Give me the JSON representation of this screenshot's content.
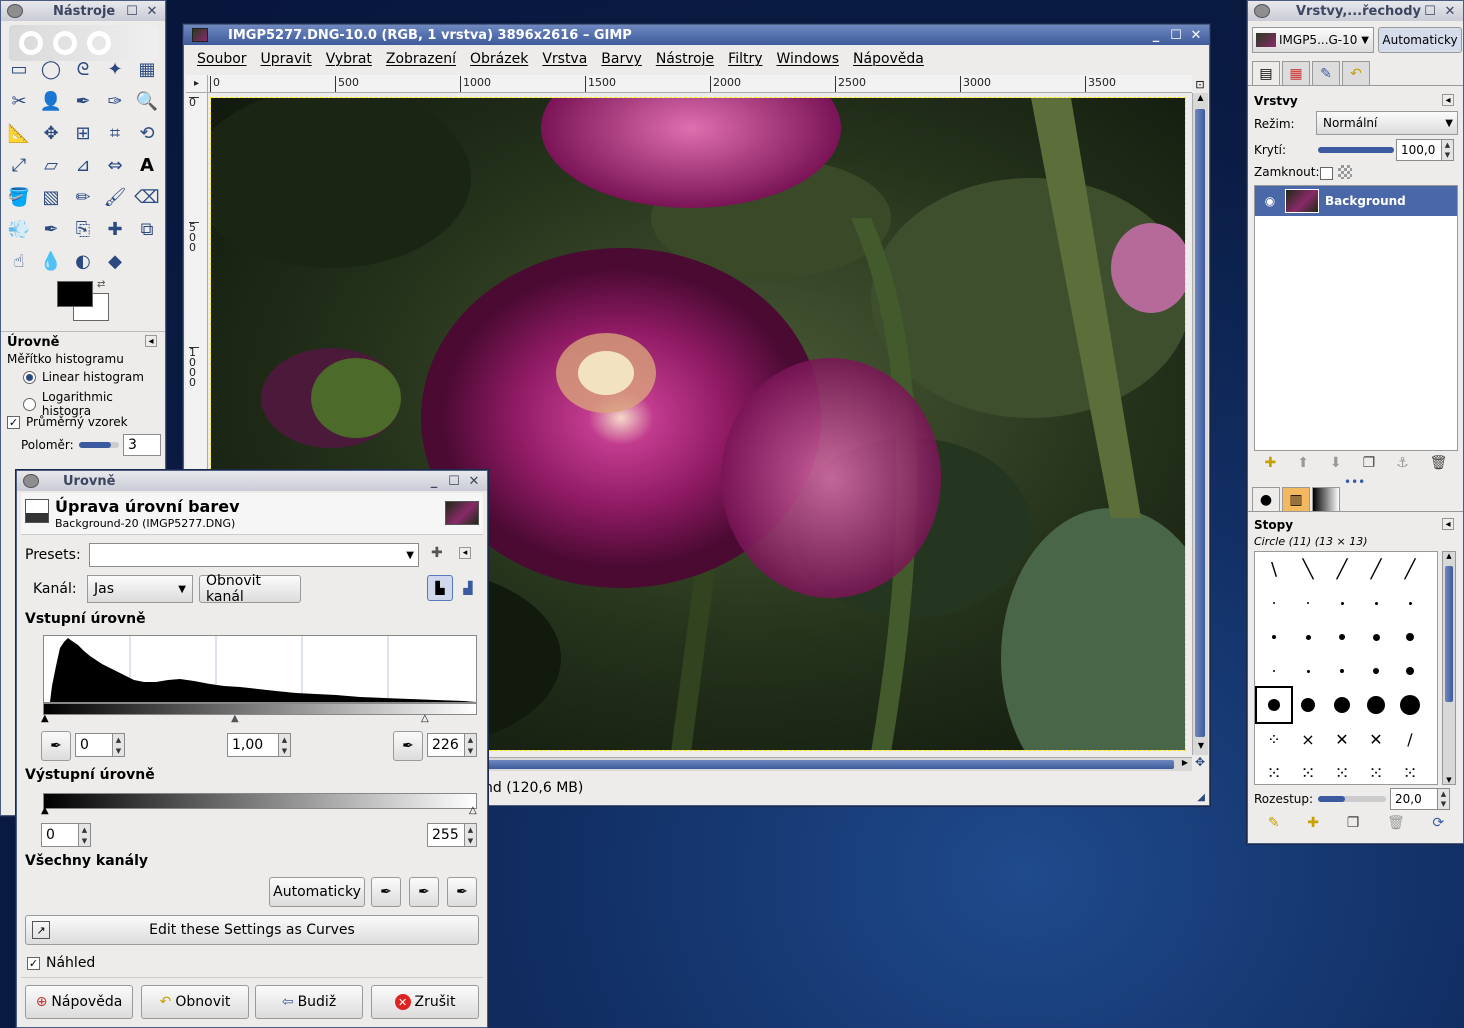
{
  "toolbox": {
    "title": "Nástroje",
    "section_title": "Úrovně",
    "histogram_scale_label": "Měřítko histogramu",
    "radio_linear": "Linear histogram",
    "radio_log": "Logarithmic histogra",
    "sample_average_label": "Průměrný vzorek",
    "radius_label": "Poloměr:",
    "radius_value": "3",
    "tools": [
      "rect-select",
      "ellipse-select",
      "free-select",
      "fuzzy-select",
      "by-color-select",
      "scissors-select",
      "foreground-select",
      "paths",
      "color-picker",
      "zoom",
      "measure",
      "move",
      "align",
      "crop",
      "rotate",
      "scale",
      "shear",
      "perspective",
      "flip",
      "text",
      "bucket-fill",
      "blend",
      "pencil",
      "paintbrush",
      "eraser",
      "airbrush",
      "ink",
      "clone",
      "heal",
      "perspective-clone",
      "smudge",
      "blur",
      "dodge-burn",
      "convolve"
    ]
  },
  "image_window": {
    "title": "IMGP5277.DNG-10.0 (RGB, 1 vrstva) 3896x2616 – GIMP",
    "menu": [
      "Soubor",
      "Upravit",
      "Vybrat",
      "Zobrazení",
      "Obrázek",
      "Vrstva",
      "Barvy",
      "Nástroje",
      "Filtry",
      "Windows",
      "Nápověda"
    ],
    "ruler_ticks": [
      "0",
      "500",
      "1000",
      "1500",
      "2000",
      "2500",
      "3000",
      "3500"
    ],
    "vruler_ticks": [
      "0",
      "500",
      "1000"
    ],
    "status": "nd (120,6 MB)"
  },
  "layers_dock": {
    "title": "Vrstvy,...řechody",
    "image_select": "IMGP5...G-10",
    "auto_button": "Automaticky",
    "layers_title": "Vrstvy",
    "mode_label": "Režim:",
    "mode_value": "Normální",
    "opacity_label": "Krytí:",
    "opacity_value": "100,0",
    "opacity_fraction": 1.0,
    "lock_label": "Zamknout:",
    "layer_name": "Background",
    "brushes_title": "Stopy",
    "brush_name": "Circle (11) (13 × 13)",
    "spacing_label": "Rozestup:",
    "spacing_value": "20,0",
    "spacing_fraction": 0.2
  },
  "levels_dialog": {
    "title": "Úrovně",
    "heading": "Úprava úrovní barev",
    "subheading": "Background-20 (IMGP5277.DNG)",
    "presets_label": "Presets:",
    "presets_value": "",
    "channel_label": "Kanál:",
    "channel_value": "Jas",
    "reset_channel": "Obnovit kanál",
    "input_levels": "Vstupní úrovně",
    "input_low": "0",
    "input_gamma": "1,00",
    "input_high": "226",
    "output_levels": "Výstupní úrovně",
    "output_low": "0",
    "output_high": "255",
    "all_channels": "Všechny kanály",
    "auto_button": "Automaticky",
    "edit_curves": "Edit these Settings as Curves",
    "preview_label": "Náhled",
    "help_button": "Nápověda",
    "reset_button": "Obnovit",
    "back_button": "Budiž",
    "cancel_button": "Zrušit"
  },
  "colors": {
    "title_active": "#4a67a8",
    "accent": "#3b5aa0",
    "fg_color": "#000000",
    "bg_color": "#ffffff"
  }
}
